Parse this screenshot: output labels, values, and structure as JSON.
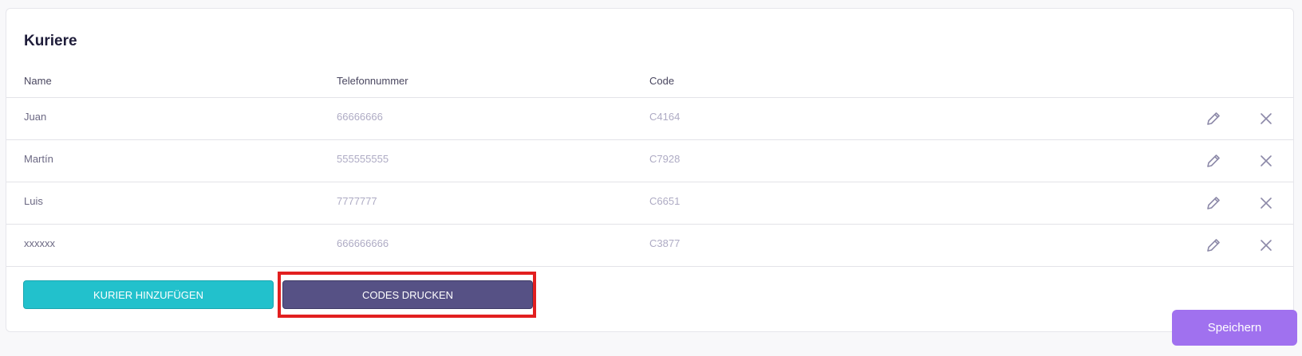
{
  "section_title": "Kuriere",
  "columns": {
    "name": "Name",
    "phone": "Telefonnummer",
    "code": "Code"
  },
  "couriers": [
    {
      "name": "Juan",
      "phone": "66666666",
      "code": "C4164"
    },
    {
      "name": "Martín",
      "phone": "555555555",
      "code": "C7928"
    },
    {
      "name": "Luis",
      "phone": "7777777",
      "code": "C6651"
    },
    {
      "name": "xxxxxx",
      "phone": "666666666",
      "code": "C3877"
    }
  ],
  "row_actions": {
    "edit_icon": "pencil-icon",
    "delete_icon": "close-icon"
  },
  "buttons": {
    "add_courier": "KURIER HINZUFÜGEN",
    "print_codes": "CODES DRUCKEN",
    "save": "Speichern"
  },
  "colors": {
    "add_button": "#22c1cc",
    "print_button": "#565185",
    "save_button": "#a071ef",
    "highlight": "#e21f1f"
  }
}
